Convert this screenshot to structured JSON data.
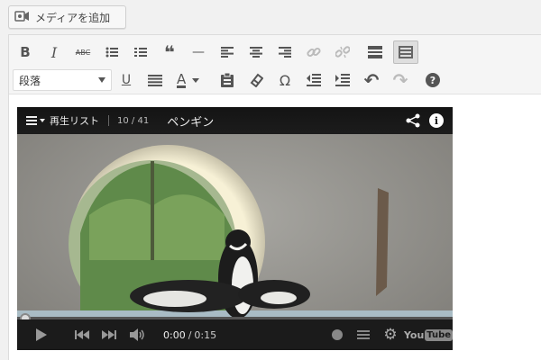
{
  "add_media": {
    "label": "メディアを追加"
  },
  "toolbar": {
    "row1": [
      {
        "name": "bold-button",
        "glyph": "B"
      },
      {
        "name": "italic-button",
        "glyph": "I"
      },
      {
        "name": "strikethrough-button",
        "glyph": "ABC"
      },
      {
        "name": "bulleted-list-button",
        "glyph": ""
      },
      {
        "name": "numbered-list-button",
        "glyph": ""
      },
      {
        "name": "blockquote-button",
        "glyph": "❝"
      },
      {
        "name": "horizontal-line-button",
        "glyph": "—"
      },
      {
        "name": "align-left-button",
        "glyph": ""
      },
      {
        "name": "align-center-button",
        "glyph": ""
      },
      {
        "name": "align-right-button",
        "glyph": ""
      },
      {
        "name": "insert-link-button",
        "glyph": "🔗"
      },
      {
        "name": "remove-link-button",
        "glyph": "⛓"
      },
      {
        "name": "read-more-button",
        "glyph": ""
      },
      {
        "name": "toolbar-toggle-button",
        "glyph": ""
      }
    ],
    "format_select_value": "段落",
    "row2": [
      {
        "name": "underline-button",
        "glyph": "U"
      },
      {
        "name": "justify-button",
        "glyph": ""
      },
      {
        "name": "text-color-button",
        "glyph": "A"
      },
      {
        "name": "paste-as-text-button",
        "glyph": ""
      },
      {
        "name": "clear-formatting-button",
        "glyph": ""
      },
      {
        "name": "special-character-button",
        "glyph": "Ω"
      },
      {
        "name": "outdent-button",
        "glyph": ""
      },
      {
        "name": "indent-button",
        "glyph": ""
      },
      {
        "name": "undo-button",
        "glyph": "↶"
      },
      {
        "name": "redo-button",
        "glyph": "↷"
      },
      {
        "name": "help-button",
        "glyph": "?"
      }
    ]
  },
  "player": {
    "playlist_label": "再生リスト",
    "playlist_position": "10 / 41",
    "video_title": "ペンギン",
    "time_current": "0:00",
    "time_separator": "/",
    "time_total": "0:15",
    "brand_text": "You",
    "brand_tube": "Tube"
  },
  "colors": {
    "player_bar": "#1b1b1b",
    "editor_background": "#ffffff",
    "toolbar_background": "#f5f5f5"
  }
}
